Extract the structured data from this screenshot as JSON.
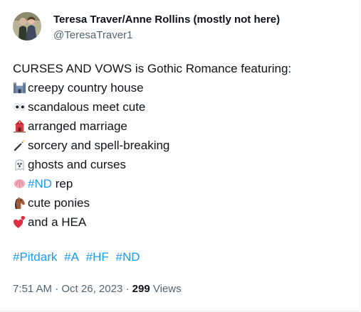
{
  "author": {
    "display_name": "Teresa Traver/Anne Rollins (mostly not here)",
    "handle": "@TeresaTraver1"
  },
  "tweet": {
    "intro": "CURSES AND VOWS is Gothic Romance featuring:",
    "items": [
      {
        "emoji": "castle-icon",
        "text": "creepy country house"
      },
      {
        "emoji": "eyes-icon",
        "text": "scandalous meet cute"
      },
      {
        "emoji": "wedding-chapel-icon",
        "text": "arranged marriage"
      },
      {
        "emoji": "magic-wand-icon",
        "text": "sorcery and spell-breaking"
      },
      {
        "emoji": "ghost-icon",
        "text": "ghosts and curses"
      },
      {
        "emoji": "brain-icon",
        "link": "#ND",
        "text": " rep"
      },
      {
        "emoji": "horse-icon",
        "text": "cute ponies"
      },
      {
        "emoji": "heart-exclamation-icon",
        "text": "and a HEA"
      }
    ],
    "hashtags": [
      "#Pitdark",
      "#A",
      "#HF",
      "#ND"
    ]
  },
  "meta": {
    "time": "7:51 AM",
    "sep1": " · ",
    "date": "Oct 26, 2023",
    "sep2": " · ",
    "views_count": "299",
    "views_label": " Views"
  },
  "colors": {
    "link": "#1d9bf0",
    "text": "#0f1419",
    "secondary": "#536471"
  }
}
